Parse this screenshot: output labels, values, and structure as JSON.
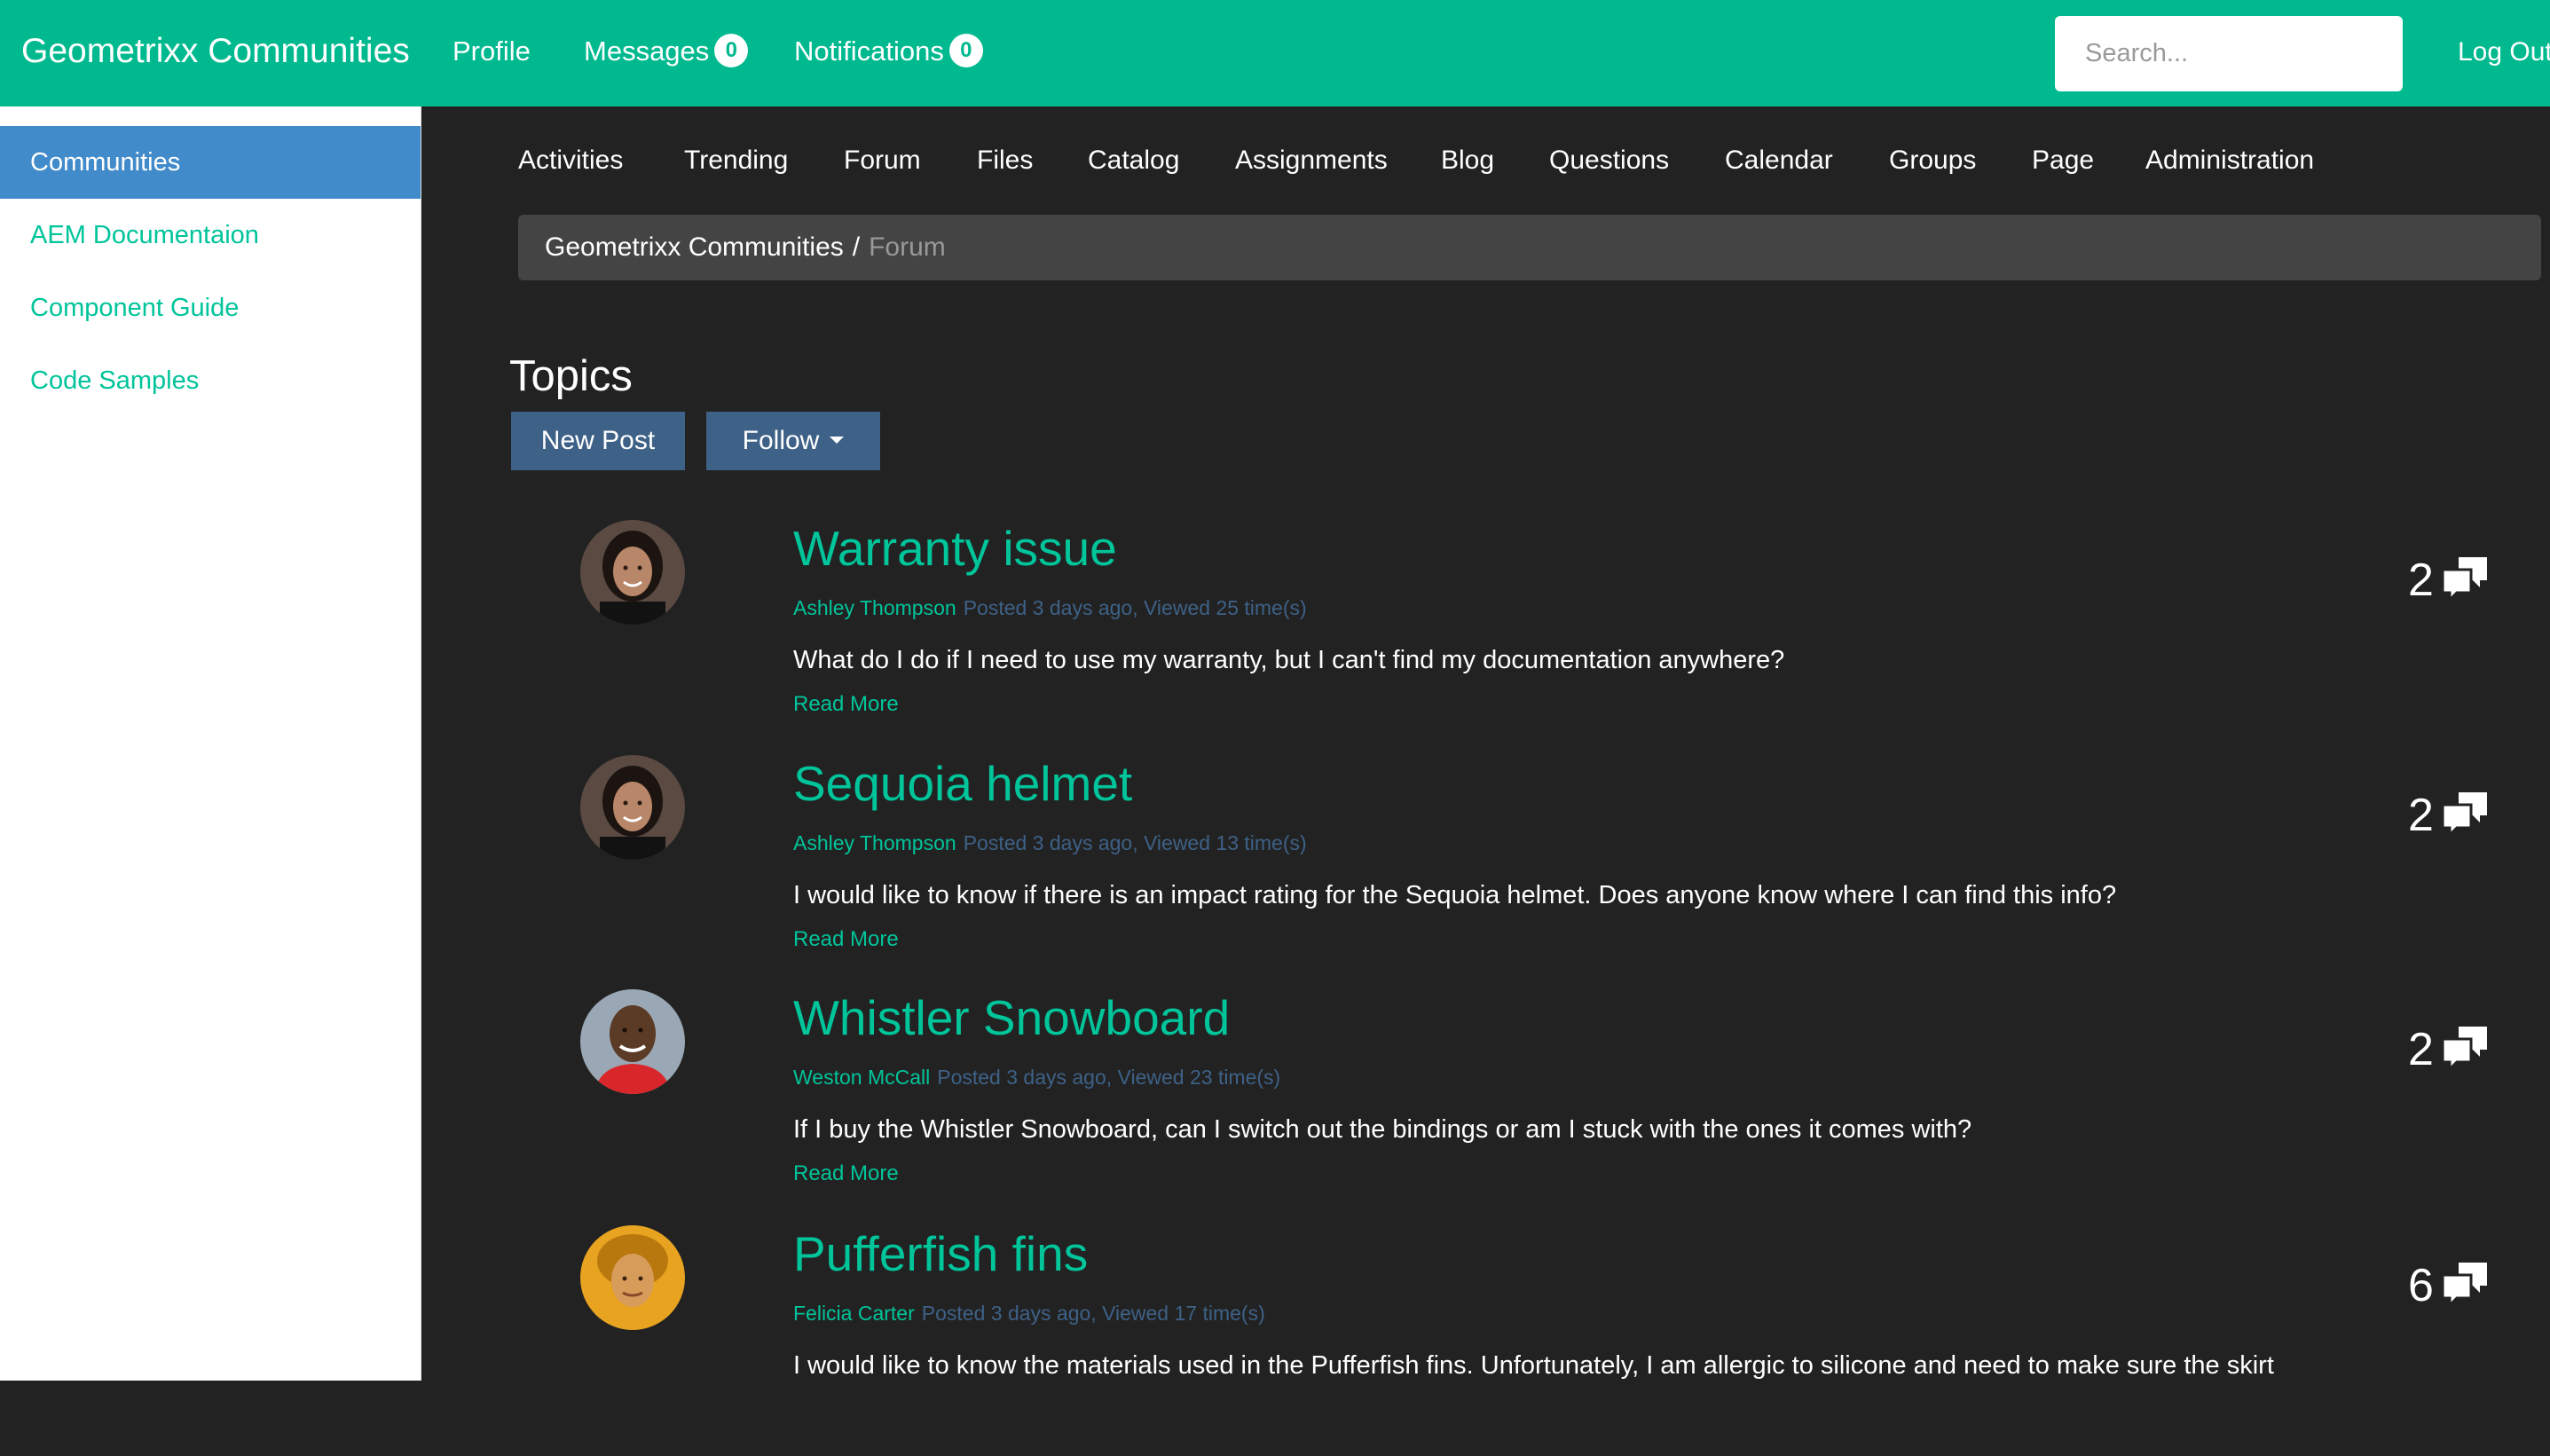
{
  "header": {
    "brand": "Geometrixx Communities",
    "profile": "Profile",
    "messages": "Messages",
    "messages_count": "0",
    "notifications": "Notifications",
    "notifications_count": "0",
    "search_placeholder": "Search...",
    "logout": "Log Out"
  },
  "sidebar": {
    "items": [
      {
        "label": "Communities",
        "active": true
      },
      {
        "label": "AEM Documentaion",
        "active": false
      },
      {
        "label": "Component Guide",
        "active": false
      },
      {
        "label": "Code Samples",
        "active": false
      }
    ]
  },
  "section_nav": [
    "Activities",
    "Trending",
    "Forum",
    "Files",
    "Catalog",
    "Assignments",
    "Blog",
    "Questions",
    "Calendar",
    "Groups",
    "Page",
    "Administration"
  ],
  "breadcrumb": {
    "parent": "Geometrixx Communities",
    "separator": "/",
    "current": "Forum"
  },
  "topics": {
    "title": "Topics",
    "new_post": "New Post",
    "follow": "Follow",
    "read_more": "Read More",
    "items": [
      {
        "title": "Warranty issue",
        "author": "Ashley Thompson",
        "stats": "Posted 3 days ago, Viewed 25 time(s)",
        "snippet": "What do I do if I need to use my warranty, but I can't find my documentation anywhere?",
        "replies": "2",
        "avatar": "woman-avatar"
      },
      {
        "title": "Sequoia helmet",
        "author": "Ashley Thompson",
        "stats": "Posted 3 days ago, Viewed 13 time(s)",
        "snippet": "I would like to know if there is an impact rating for the Sequoia helmet. Does anyone know where I can find this info?",
        "replies": "2",
        "avatar": "woman-avatar"
      },
      {
        "title": "Whistler Snowboard",
        "author": "Weston McCall",
        "stats": "Posted 3 days ago, Viewed 23 time(s)",
        "snippet": "If I buy the Whistler Snowboard, can I switch out the bindings or am I stuck with the ones it comes with?",
        "replies": "2",
        "avatar": "man-avatar"
      },
      {
        "title": "Pufferfish fins",
        "author": "Felicia Carter",
        "stats": "Posted 3 days ago, Viewed 17 time(s)",
        "snippet": "I would like to know the materials used in the Pufferfish fins. Unfortunately, I am allergic to silicone and need to make sure the skirt",
        "replies": "6",
        "avatar": "woman-avatar-yellow"
      }
    ]
  },
  "colors": {
    "brand_green": "#00b98f",
    "link_green": "#00c49a",
    "active_blue": "#428bca",
    "button_blue": "#3e6187",
    "background": "#222222"
  }
}
